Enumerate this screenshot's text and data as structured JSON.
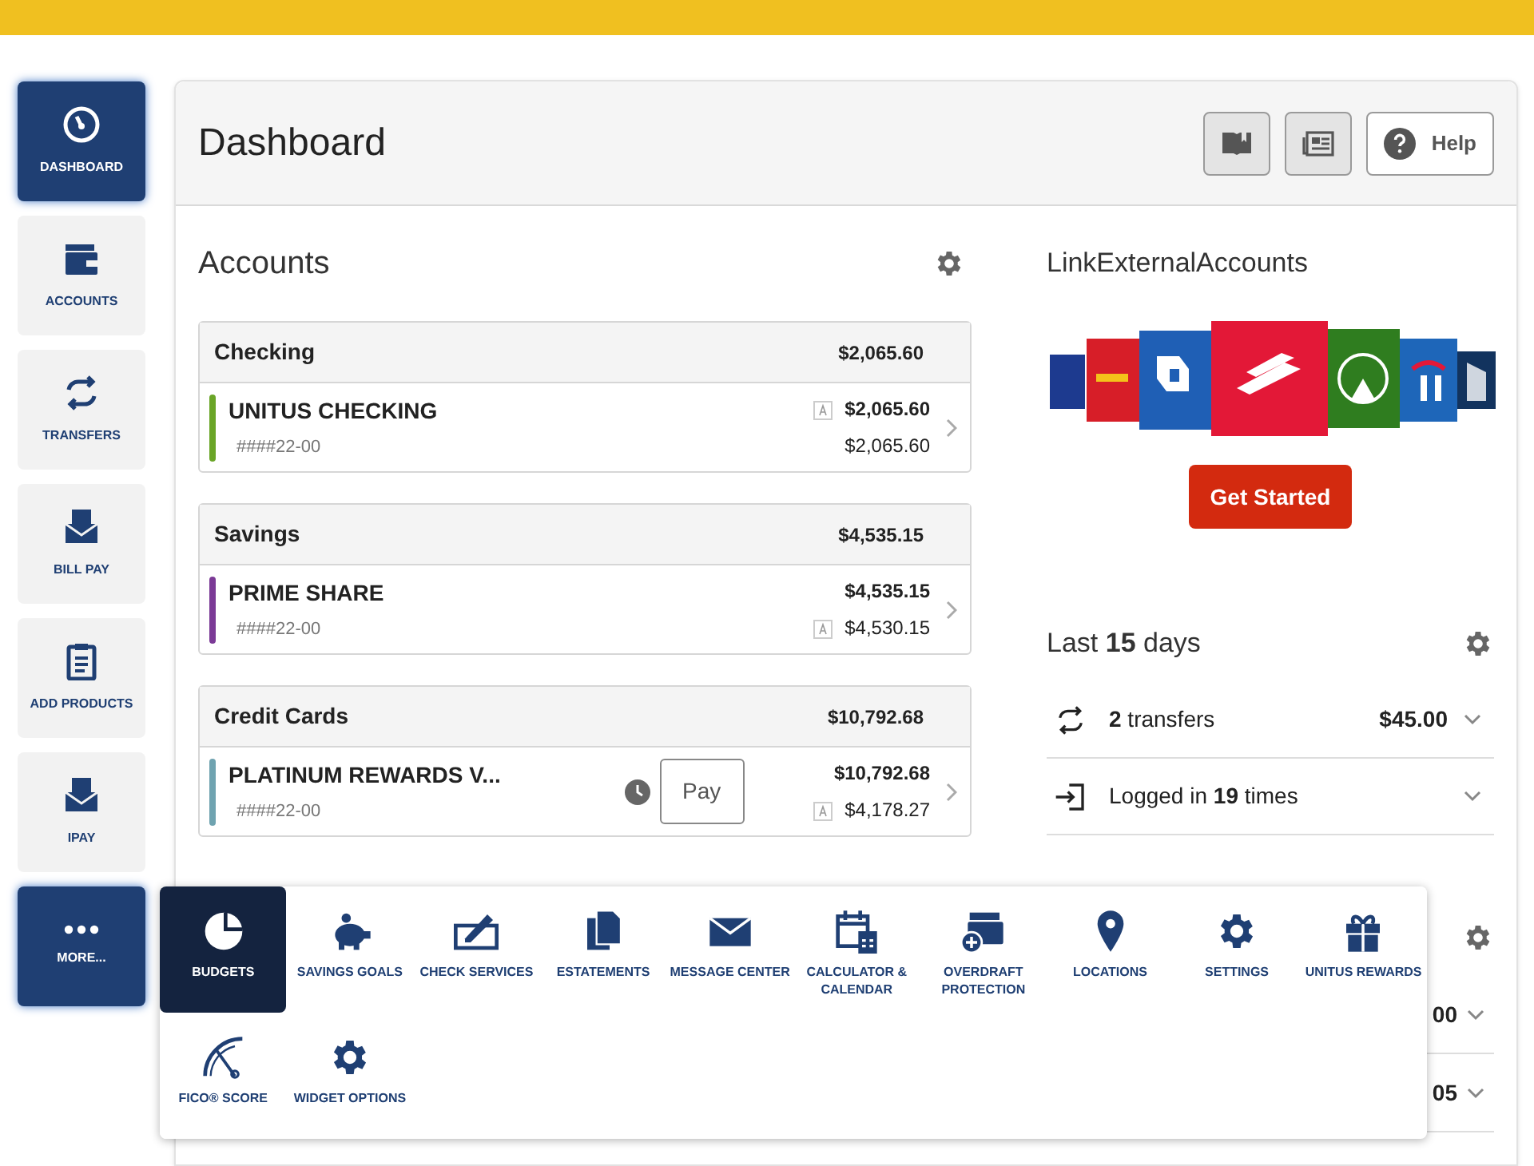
{
  "sidebar": {
    "items": [
      {
        "label": "DASHBOARD",
        "selected": true
      },
      {
        "label": "ACCOUNTS",
        "selected": false
      },
      {
        "label": "TRANSFERS",
        "selected": false
      },
      {
        "label": "BILL PAY",
        "selected": false
      },
      {
        "label": "ADD PRODUCTS",
        "selected": false
      },
      {
        "label": "IPAY",
        "selected": false
      },
      {
        "label": "MORE...",
        "selected": true
      }
    ]
  },
  "header": {
    "title": "Dashboard",
    "help_button": "Help"
  },
  "accounts": {
    "title": "Accounts",
    "groups": [
      {
        "title": "Checking",
        "total": "$2,065.60",
        "accounts": [
          {
            "name": "UNITUS CHECKING",
            "number": "####22-00",
            "color": "#6aa527",
            "balance": "$2,065.60",
            "available": "$2,065.60",
            "balance_badge": true,
            "available_badge": false,
            "pending": false
          }
        ]
      },
      {
        "title": "Savings",
        "total": "$4,535.15",
        "accounts": [
          {
            "name": "PRIME SHARE",
            "number": "####22-00",
            "color": "#7b3a96",
            "balance": "$4,535.15",
            "available": "$4,530.15",
            "balance_badge": false,
            "available_badge": true,
            "pending": false
          }
        ]
      },
      {
        "title": "Credit Cards",
        "total": "$10,792.68",
        "accounts": [
          {
            "name": "PLATINUM REWARDS V...",
            "number": "####22-00",
            "color": "#6fa3b0",
            "balance": "$10,792.68",
            "available": "$4,178.27",
            "balance_badge": false,
            "available_badge": true,
            "pending": true,
            "pay_button": "Pay"
          }
        ]
      }
    ]
  },
  "link_external": {
    "title": "LinkExternalAccounts",
    "button": "Get Started"
  },
  "activity": {
    "title": "Last **15** days",
    "rows": [
      {
        "text": "**2** transfers",
        "amount": "$45.00"
      },
      {
        "text": "Logged in **19** times"
      }
    ]
  },
  "widget": {
    "rows": [
      {
        "amount": "00"
      },
      {
        "amount": "05"
      }
    ]
  },
  "more_menu": {
    "items": [
      {
        "label": "BUDGETS",
        "selected": true
      },
      {
        "label": "SAVINGS GOALS",
        "selected": false
      },
      {
        "label": "CHECK SERVICES",
        "selected": false
      },
      {
        "label": "ESTATEMENTS",
        "selected": false
      },
      {
        "label": "MESSAGE CENTER",
        "selected": false
      },
      {
        "label": "CALCULATOR & CALENDAR",
        "selected": false
      },
      {
        "label": "OVERDRAFT PROTECTION",
        "selected": false
      },
      {
        "label": "LOCATIONS",
        "selected": false
      },
      {
        "label": "SETTINGS",
        "selected": false
      },
      {
        "label": "UNITUS REWARDS",
        "selected": false
      },
      {
        "label": "FICO® SCORE",
        "selected": false
      },
      {
        "label": "WIDGET OPTIONS",
        "selected": false
      }
    ]
  }
}
